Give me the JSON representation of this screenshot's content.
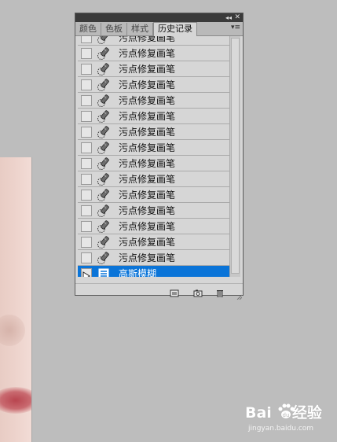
{
  "panel": {
    "tabs": [
      {
        "label": "颜色",
        "active": false
      },
      {
        "label": "色板",
        "active": false
      },
      {
        "label": "样式",
        "active": false
      },
      {
        "label": "历史记录",
        "active": true
      }
    ],
    "collapse_glyph": "◂◂",
    "close_glyph": "✕",
    "menu_glyph": "▾≡",
    "rows": [
      {
        "label": "污点修复画笔",
        "icon": "spot-healing-brush-icon",
        "selected": false
      },
      {
        "label": "污点修复画笔",
        "icon": "spot-healing-brush-icon",
        "selected": false
      },
      {
        "label": "污点修复画笔",
        "icon": "spot-healing-brush-icon",
        "selected": false
      },
      {
        "label": "污点修复画笔",
        "icon": "spot-healing-brush-icon",
        "selected": false
      },
      {
        "label": "污点修复画笔",
        "icon": "spot-healing-brush-icon",
        "selected": false
      },
      {
        "label": "污点修复画笔",
        "icon": "spot-healing-brush-icon",
        "selected": false
      },
      {
        "label": "污点修复画笔",
        "icon": "spot-healing-brush-icon",
        "selected": false
      },
      {
        "label": "污点修复画笔",
        "icon": "spot-healing-brush-icon",
        "selected": false
      },
      {
        "label": "污点修复画笔",
        "icon": "spot-healing-brush-icon",
        "selected": false
      },
      {
        "label": "污点修复画笔",
        "icon": "spot-healing-brush-icon",
        "selected": false
      },
      {
        "label": "污点修复画笔",
        "icon": "spot-healing-brush-icon",
        "selected": false
      },
      {
        "label": "污点修复画笔",
        "icon": "spot-healing-brush-icon",
        "selected": false
      },
      {
        "label": "污点修复画笔",
        "icon": "spot-healing-brush-icon",
        "selected": false
      },
      {
        "label": "污点修复画笔",
        "icon": "spot-healing-brush-icon",
        "selected": false
      },
      {
        "label": "污点修复画笔",
        "icon": "spot-healing-brush-icon",
        "selected": false
      },
      {
        "label": "高斯模糊",
        "icon": "filter-icon",
        "selected": true
      }
    ],
    "bottom_buttons": [
      "new-document-from-state-icon",
      "new-snapshot-icon",
      "trash-icon"
    ]
  },
  "watermark": {
    "main": "Bai",
    "main2": "经验",
    "sub": "jingyan.baidu.com"
  },
  "colors": {
    "selected_row": "#0a74d8",
    "panel_bg": "#d6d6d6",
    "workspace_bg": "#bdbdbd"
  }
}
